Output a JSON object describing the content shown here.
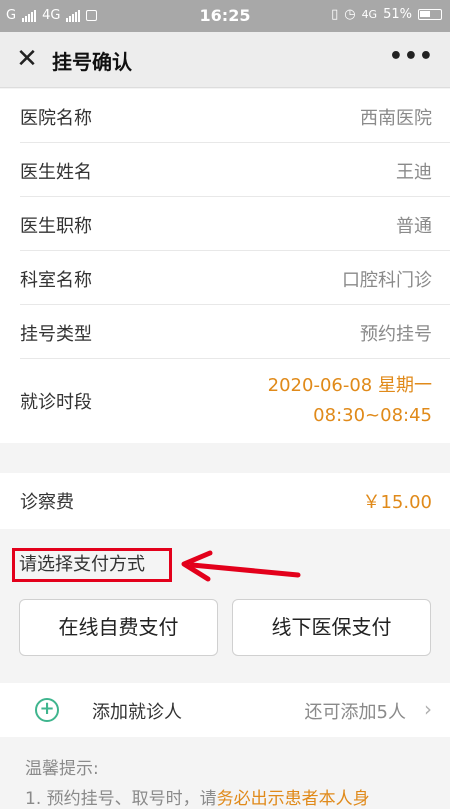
{
  "status_bar": {
    "carrier1": "G",
    "carrier2": "4G",
    "time": "16:25",
    "network": "4G",
    "battery": "51%"
  },
  "header": {
    "title": "挂号确认"
  },
  "details": [
    {
      "label": "医院名称",
      "value": "西南医院"
    },
    {
      "label": "医生姓名",
      "value": "王迪"
    },
    {
      "label": "医生职称",
      "value": "普通"
    },
    {
      "label": "科室名称",
      "value": "口腔科门诊"
    },
    {
      "label": "挂号类型",
      "value": "预约挂号"
    }
  ],
  "visit_time": {
    "label": "就诊时段",
    "date": "2020-06-08 星期一",
    "time": "08:30~08:45"
  },
  "fee": {
    "label": "诊察费",
    "value": "￥15.00"
  },
  "payment": {
    "title": "请选择支付方式",
    "online_label": "在线自费支付",
    "offline_label": "线下医保支付"
  },
  "patient": {
    "label": "添加就诊人",
    "value": "还可添加5人"
  },
  "tips": {
    "title": "温馨提示:",
    "line1_prefix": "1. 预约挂号、取号时，请",
    "line1_highlight": "务必出示患者本人身"
  },
  "colors": {
    "accent": "#e08a1a",
    "highlight_box": "#e3001b",
    "add_icon": "#3fb58e"
  }
}
